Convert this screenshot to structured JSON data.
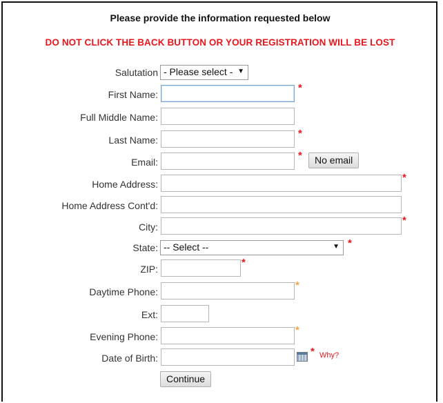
{
  "header": {
    "title": "Please provide the information requested below",
    "warning": "DO NOT CLICK THE BACK BUTTON OR YOUR REGISTRATION WILL BE LOST"
  },
  "form": {
    "salutation": {
      "label": "Salutation",
      "selected": "- Please select -"
    },
    "first_name": {
      "label": "First Name:",
      "value": ""
    },
    "middle_name": {
      "label": "Full Middle Name:",
      "value": ""
    },
    "last_name": {
      "label": "Last Name:",
      "value": ""
    },
    "email": {
      "label": "Email:",
      "value": "",
      "no_email_label": "No email"
    },
    "home_address": {
      "label": "Home Address:",
      "value": ""
    },
    "home_address_2": {
      "label": "Home Address Cont'd:",
      "value": ""
    },
    "city": {
      "label": "City:",
      "value": ""
    },
    "state": {
      "label": "State:",
      "selected": "-- Select --"
    },
    "zip": {
      "label": "ZIP:",
      "value": ""
    },
    "day_phone": {
      "label": "Daytime Phone:",
      "value": ""
    },
    "ext": {
      "label": "Ext:",
      "value": ""
    },
    "eve_phone": {
      "label": "Evening Phone:",
      "value": ""
    },
    "dob": {
      "label": "Date of Birth:",
      "value": "",
      "why_label": "Why?"
    },
    "required_marker": "*",
    "continue_label": "Continue"
  },
  "colors": {
    "required": "#e8171c",
    "optional_required": "#f0a24a",
    "warning": "#e8171c"
  },
  "icons": {
    "dob_picker": "calendar-icon",
    "select_arrow": "chevron-down-icon"
  }
}
